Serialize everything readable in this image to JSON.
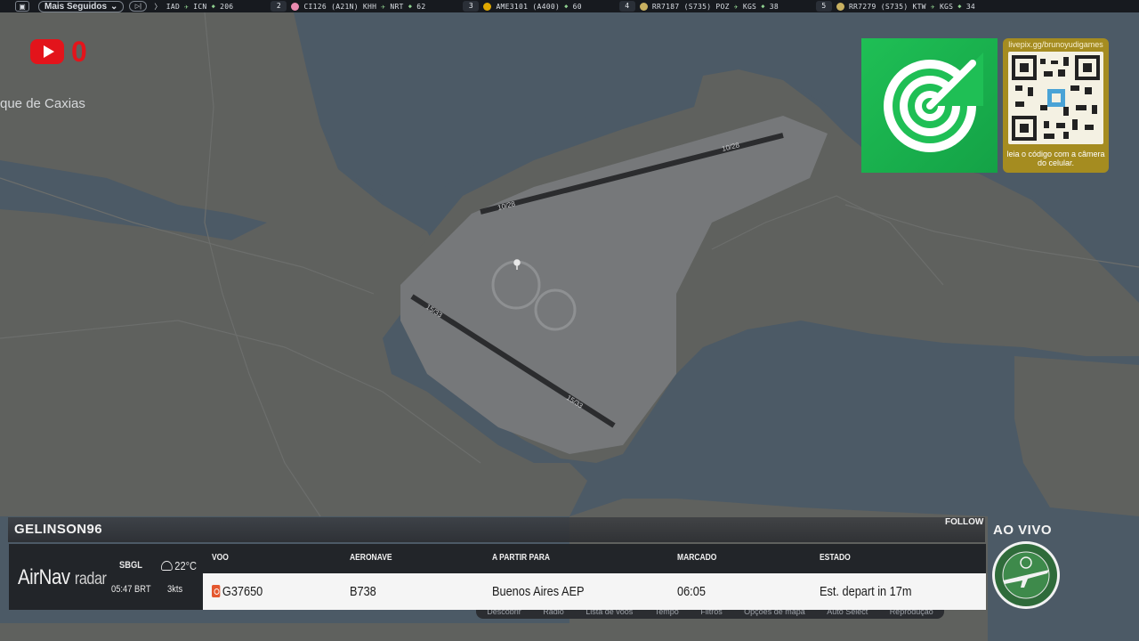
{
  "topbar": {
    "filter_label": "Mais Seguidos",
    "first_route": {
      "from": "IAD",
      "to": "ICN",
      "count": "206"
    },
    "tickers": [
      {
        "rank": "2",
        "flight": "CI126 (A21N)",
        "from": "KHH",
        "to": "NRT",
        "count": "62",
        "logo_color": "#e98bb0"
      },
      {
        "rank": "3",
        "flight": "AME3101 (A400)",
        "from": "",
        "to": "",
        "count": "60",
        "logo_color": "#e0a800"
      },
      {
        "rank": "4",
        "flight": "RR7187 (S735)",
        "from": "POZ",
        "to": "KGS",
        "count": "38",
        "logo_color": "#c8b060"
      },
      {
        "rank": "5",
        "flight": "RR7279 (S735)",
        "from": "KTW",
        "to": "KGS",
        "count": "34",
        "logo_color": "#c8b060"
      }
    ]
  },
  "youtube": {
    "count": "0"
  },
  "map": {
    "place_label": "que de Caxias",
    "runway_labels": [
      "10/28",
      "10/28",
      "15/33",
      "15/33"
    ]
  },
  "promo": {
    "link": "livepix.gg/brunoyudigames",
    "caption": "leia o código com a câmera do celular."
  },
  "flight_panel": {
    "pilot": "GELINSON96",
    "follow": "FOLLOW",
    "brand": "AirNav",
    "brand_suffix": "radar",
    "weather": {
      "icao": "SBGL",
      "time": "05:47 BRT",
      "temp": "22°C",
      "wind": "3kts"
    },
    "headers": {
      "flight": "VOO",
      "aircraft": "AERONAVE",
      "from_to": "A PARTIR PARA",
      "scheduled": "MARCADO",
      "status": "ESTADO"
    },
    "row": {
      "flight": "G37650",
      "aircraft": "B738",
      "destination": "Buenos Aires AEP",
      "scheduled": "06:05",
      "status": "Est. depart in 17m"
    }
  },
  "bottom_menu": [
    "Descobrir",
    "Rádio",
    "Lista de voos",
    "Tempo",
    "Filtros",
    "Opções de mapa",
    "Auto Select",
    "Reprodução"
  ],
  "live_label": "AO VIVO",
  "colors": {
    "map_water": "#4c5a66",
    "map_land": "#5f615e",
    "airport": "#76787a",
    "youtube_red": "#e3141b",
    "radar_green": "#1fbf55",
    "qr_gold": "#a58c20"
  }
}
